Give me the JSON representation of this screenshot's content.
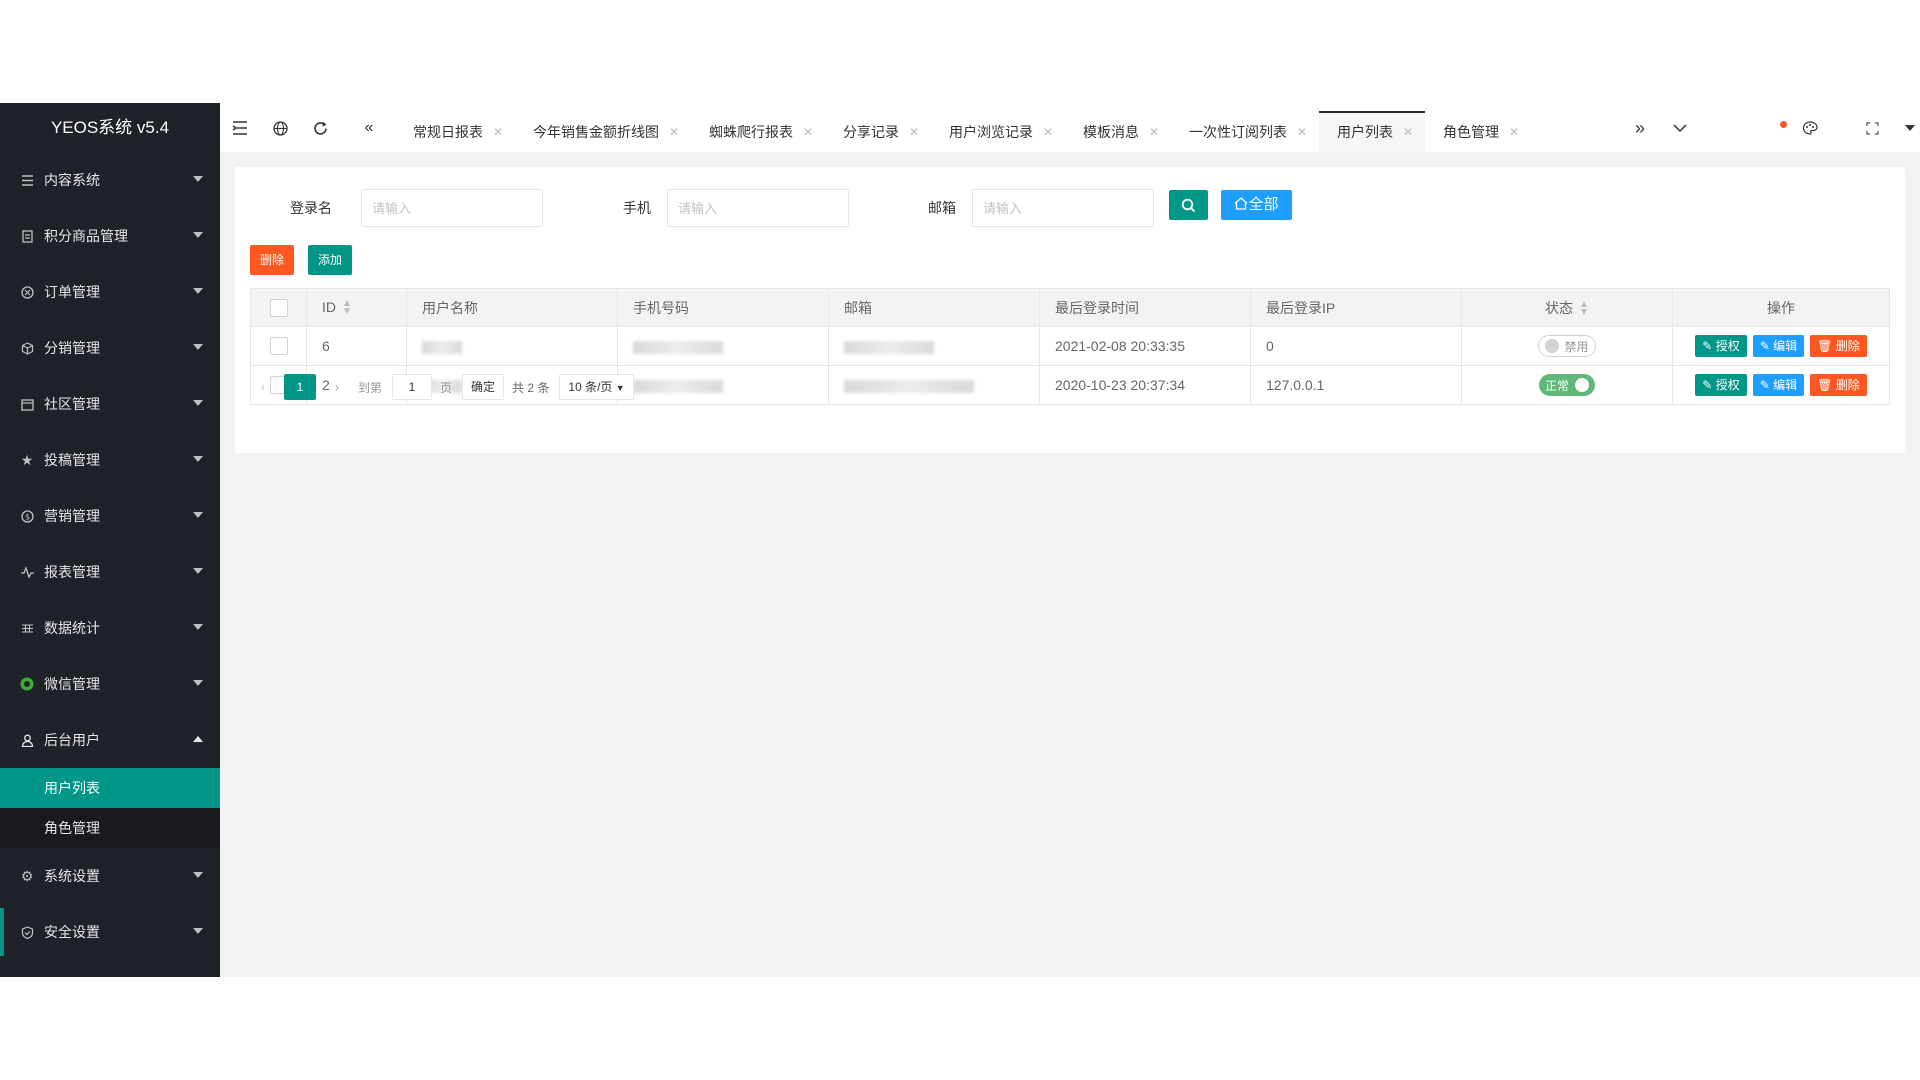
{
  "brand": "YEOS系统 v5.4",
  "sidebar": {
    "items": [
      {
        "label": "内容系统",
        "icon": "list-icon"
      },
      {
        "label": "积分商品管理",
        "icon": "doc-icon"
      },
      {
        "label": "订单管理",
        "icon": "circle-star-icon"
      },
      {
        "label": "分销管理",
        "icon": "cube-icon"
      },
      {
        "label": "社区管理",
        "icon": "calendar-icon"
      },
      {
        "label": "投稿管理",
        "icon": "star-icon"
      },
      {
        "label": "营销管理",
        "icon": "coin-icon"
      },
      {
        "label": "报表管理",
        "icon": "pulse-icon"
      },
      {
        "label": "数据统计",
        "icon": "grid-icon"
      },
      {
        "label": "微信管理",
        "icon": "wechat-icon"
      },
      {
        "label": "后台用户",
        "icon": "user-icon"
      }
    ],
    "submenu": [
      "用户列表",
      "角色管理"
    ],
    "bottom_items": [
      {
        "label": "系统设置",
        "icon": "gear-icon"
      },
      {
        "label": "安全设置",
        "icon": "shield-icon"
      }
    ]
  },
  "tabs": [
    "常规日报表",
    "今年销售金额折线图",
    "蜘蛛爬行报表",
    "分享记录",
    "用户浏览记录",
    "模板消息",
    "一次性订阅列表",
    "用户列表",
    "角色管理"
  ],
  "active_tab": "用户列表",
  "search": {
    "login_label": "登录名",
    "phone_label": "手机",
    "email_label": "邮箱",
    "placeholder": "请输入",
    "all_label": "全部"
  },
  "toolbar": {
    "delete_label": "删除",
    "add_label": "添加"
  },
  "table": {
    "headers": [
      "ID",
      "用户名称",
      "手机号码",
      "邮箱",
      "最后登录时间",
      "最后登录IP",
      "状态",
      "操作"
    ],
    "rows": [
      {
        "id": "6",
        "login_time": "2021-02-08 20:33:35",
        "login_ip": "0",
        "status": "禁用",
        "status_on": false
      },
      {
        "id": "2",
        "login_time": "2020-10-23 20:37:34",
        "login_ip": "127.0.0.1",
        "status": "正常",
        "status_on": true
      }
    ],
    "actions": {
      "auth": "授权",
      "edit": "编辑",
      "delete": "删除"
    }
  },
  "pager": {
    "current": "1",
    "goto_label": "到第",
    "goto_value": "1",
    "page_label": "页",
    "confirm_label": "确定",
    "total": "共 2 条",
    "page_size": "10 条/页"
  },
  "colors": {
    "sidebar_bg": "#20222a",
    "primary": "#009688",
    "blue": "#1e9fff",
    "danger": "#ff5722",
    "switch_on": "#5fb878"
  }
}
